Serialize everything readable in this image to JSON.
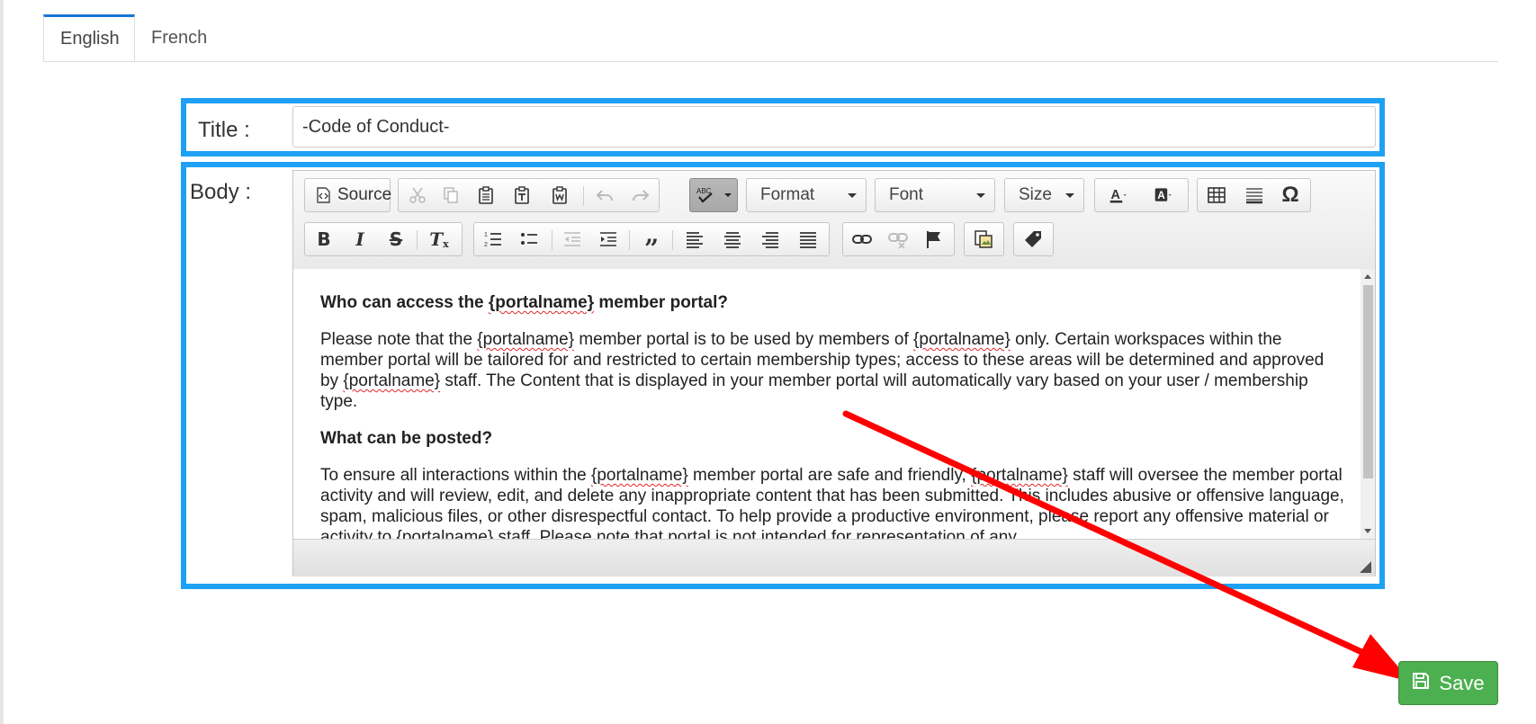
{
  "tabs": [
    {
      "label": "English",
      "active": true
    },
    {
      "label": "French",
      "active": false
    }
  ],
  "form": {
    "title_label": "Title :",
    "title_value": "-Code of Conduct-",
    "body_label": "Body :"
  },
  "toolbar": {
    "source_label": "Source",
    "format_label": "Format",
    "font_label": "Font",
    "size_label": "Size",
    "icons": [
      "source-icon",
      "cut-icon",
      "copy-icon",
      "paste-icon",
      "paste-text-icon",
      "paste-word-icon",
      "undo-icon",
      "redo-icon",
      "spellcheck-icon",
      "text-color-icon",
      "background-color-icon",
      "table-icon",
      "horizontal-line-icon",
      "special-character-icon",
      "bold-icon",
      "italic-icon",
      "strikethrough-icon",
      "remove-format-icon",
      "numbered-list-icon",
      "bulleted-list-icon",
      "decrease-indent-icon",
      "increase-indent-icon",
      "blockquote-icon",
      "align-left-icon",
      "align-center-icon",
      "align-right-icon",
      "justify-icon",
      "link-icon",
      "unlink-icon",
      "anchor-icon",
      "templates-icon",
      "tag-icon"
    ]
  },
  "content": {
    "h1": {
      "a": "Who can access the ",
      "b": "{portalname}",
      "c": " member portal?"
    },
    "p1": {
      "a": "Please note that the ",
      "b": "{portalname}",
      "c": " member portal is to be used by members of ",
      "d": "{portalname}",
      "e": " only. Certain workspaces within the member portal will be tailored for and restricted to certain membership types; access to these areas will be determined and approved by ",
      "f": "{portalname}",
      "g": " staff. The Content that is displayed in your member portal will automatically vary based on your user / membership type."
    },
    "h2": "What can be posted?",
    "p2": {
      "a": "To ensure all interactions within the ",
      "b": "{portalname}",
      "c": " member portal are safe and friendly, ",
      "d": "{portalname}",
      "e": " staff will oversee the member portal activity and will review, edit, and delete any inappropriate content that has been submitted. This includes abusive or offensive language, spam, malicious files, or other disrespectful contact. To help provide a productive environment, please report any offensive material or activity to {portalname} staff. Please note that portal is not intended for representation of any"
    }
  },
  "save_button": {
    "label": "Save"
  },
  "colors": {
    "highlight": "#1ea1f5",
    "arrow": "#ff0000",
    "save": "#4caf50",
    "tab_accent": "#1a76d2"
  }
}
